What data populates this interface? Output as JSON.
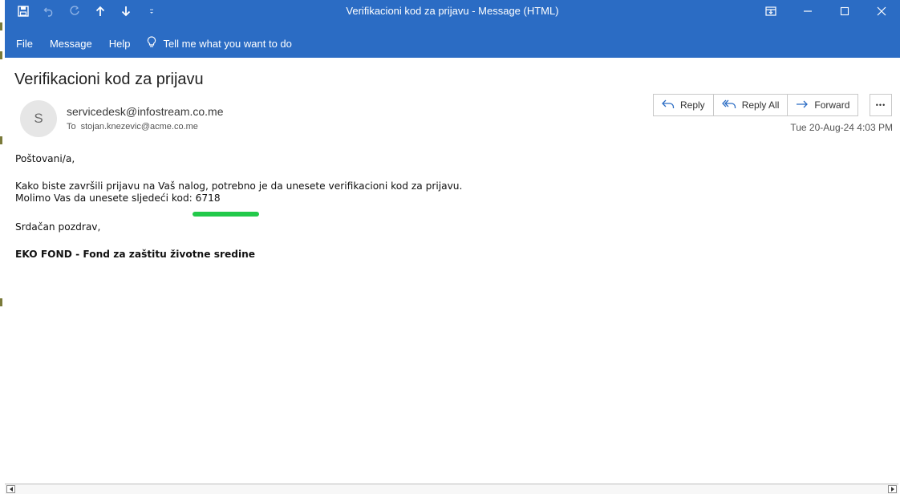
{
  "window": {
    "title": "Verifikacioni kod za prijavu  -  Message (HTML)"
  },
  "quick_access": {
    "icons": [
      "save-icon",
      "undo-icon",
      "redo-icon",
      "up-arrow-icon",
      "down-arrow-icon",
      "customize-icon"
    ]
  },
  "menu": {
    "file": "File",
    "message": "Message",
    "help": "Help",
    "tell_me": "Tell me what you want to do"
  },
  "message": {
    "subject": "Verifikacioni kod za prijavu",
    "avatar_initial": "S",
    "from": "servicedesk@infostream.co.me",
    "to_label": "To",
    "to": "stojan.knezevic@acme.co.me",
    "date": "Tue 20-Aug-24 4:03 PM"
  },
  "actions": {
    "reply": "Reply",
    "reply_all": "Reply All",
    "forward": "Forward",
    "more": "•••"
  },
  "body": {
    "greeting": "Poštovani/a,",
    "line1": "Kako biste završili prijavu na Vaš nalog, potrebno je da unesete verifikacioni kod za prijavu.",
    "line2": "Molimo Vas da unesete sljedeći kod: 6718",
    "closing": "Srdačan pozdrav,",
    "signature": "EKO FOND - Fond za zaštitu životne sredine"
  },
  "colors": {
    "titlebar": "#2b6cc4",
    "highlight": "#22c94a"
  }
}
